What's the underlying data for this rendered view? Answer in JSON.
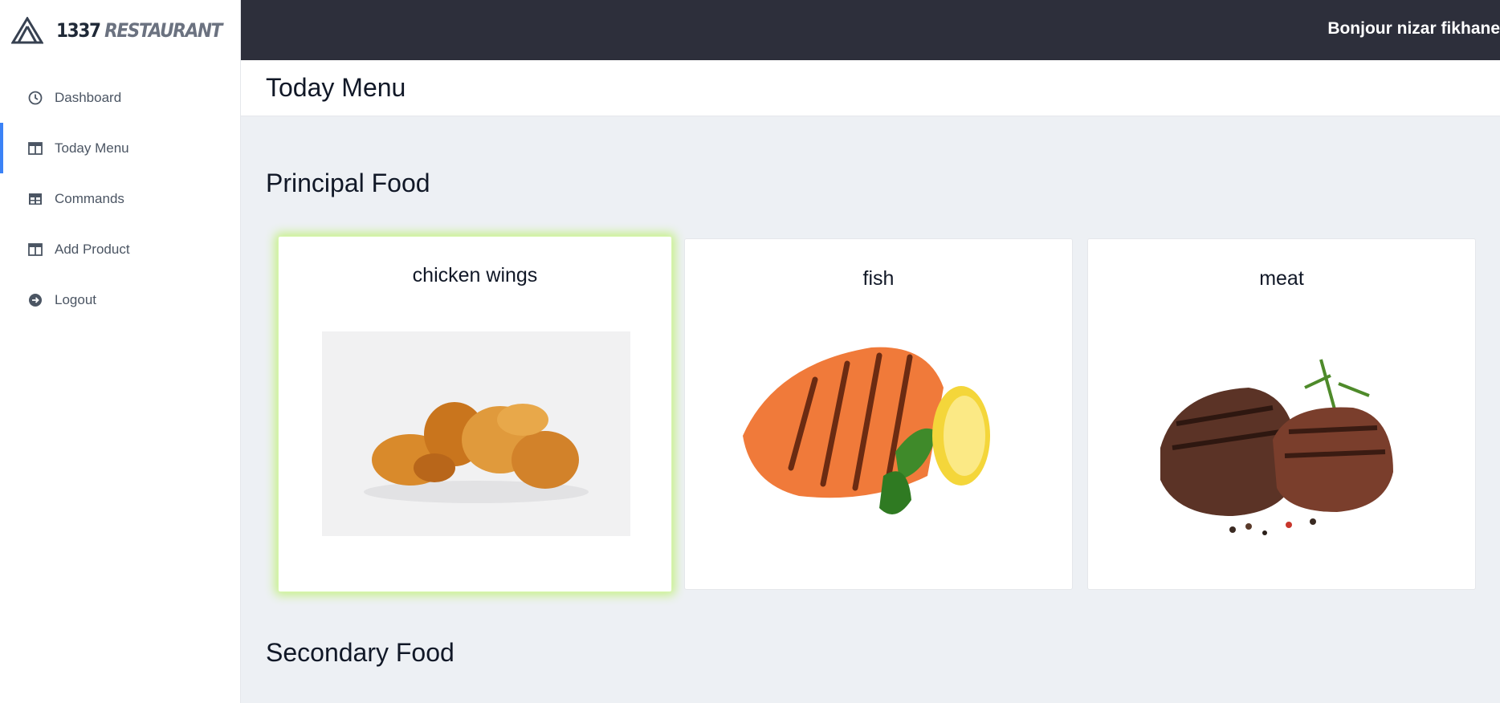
{
  "brand": {
    "name_part1": "1337",
    "name_part2": "RESTAURANT",
    "logo_icon": "triangle-logo-icon"
  },
  "sidebar": {
    "items": [
      {
        "label": "Dashboard",
        "icon": "clock-icon",
        "active": false
      },
      {
        "label": "Today Menu",
        "icon": "table-icon",
        "active": true
      },
      {
        "label": "Commands",
        "icon": "grid-table-icon",
        "active": false
      },
      {
        "label": "Add Product",
        "icon": "table-icon",
        "active": false
      },
      {
        "label": "Logout",
        "icon": "arrow-circle-icon",
        "active": false
      }
    ]
  },
  "header": {
    "greeting": "Bonjour nizar fikhane"
  },
  "page": {
    "title": "Today Menu"
  },
  "sections": {
    "principal": {
      "title": "Principal Food",
      "items": [
        {
          "name": "chicken wings",
          "image": "chicken-wings-image",
          "highlighted": true
        },
        {
          "name": "fish",
          "image": "grilled-salmon-image",
          "highlighted": false
        },
        {
          "name": "meat",
          "image": "grilled-steak-image",
          "highlighted": false
        }
      ]
    },
    "secondary": {
      "title": "Secondary Food"
    }
  },
  "colors": {
    "topbar": "#2d2f3b",
    "accent": "#3b82f6",
    "highlight_glow": "#c7f08a",
    "content_bg": "#edf0f4"
  }
}
